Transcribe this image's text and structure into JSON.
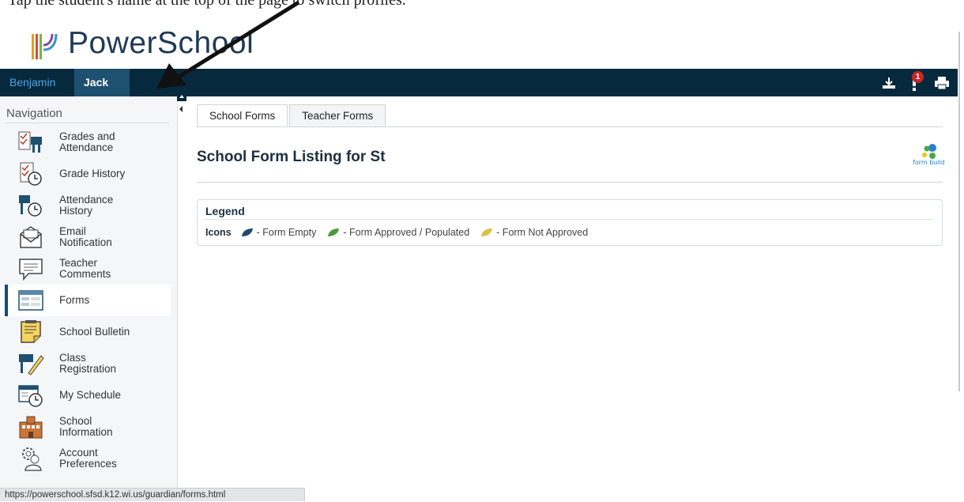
{
  "caption": "Tap the student's name at the top of the page to switch profiles.",
  "brand": {
    "name": "PowerSchool"
  },
  "students": [
    {
      "name": "Benjamin",
      "active": false
    },
    {
      "name": "Jack",
      "active": true
    }
  ],
  "header_icons": {
    "download": "download-icon",
    "notifications": "bell-icon",
    "notifications_count": "1",
    "print": "printer-icon"
  },
  "sidebar": {
    "title": "Navigation",
    "items": [
      {
        "label": "Grades and Attendance",
        "icon": "grades-attendance-icon",
        "active": false
      },
      {
        "label": "Grade History",
        "icon": "grade-history-icon",
        "active": false
      },
      {
        "label": "Attendance History",
        "icon": "attendance-history-icon",
        "active": false
      },
      {
        "label": "Email Notification",
        "icon": "email-icon",
        "active": false
      },
      {
        "label": "Teacher Comments",
        "icon": "comments-icon",
        "active": false
      },
      {
        "label": "Forms",
        "icon": "forms-icon",
        "active": true
      },
      {
        "label": "School Bulletin",
        "icon": "bulletin-icon",
        "active": false
      },
      {
        "label": "Class Registration",
        "icon": "registration-icon",
        "active": false
      },
      {
        "label": "My Schedule",
        "icon": "schedule-icon",
        "active": false
      },
      {
        "label": "School Information",
        "icon": "school-icon",
        "active": false
      },
      {
        "label": "Account Preferences",
        "icon": "account-icon",
        "active": false
      }
    ]
  },
  "main": {
    "tabs": [
      {
        "label": "School Forms",
        "active": true
      },
      {
        "label": "Teacher Forms",
        "active": false
      }
    ],
    "title": "School Form Listing for St",
    "logo": "form builder",
    "legend": {
      "title": "Legend",
      "lead": "Icons",
      "items": [
        {
          "label": "- Form Empty",
          "color": "#1f4a6b"
        },
        {
          "label": "- Form Approved / Populated",
          "color": "#4a9a3a"
        },
        {
          "label": "- Form Not Approved",
          "color": "#d8c24a"
        }
      ]
    }
  },
  "status_url": "https://powerschool.sfsd.k12.wi.us/guardian/forms.html",
  "colors": {
    "topbar": "#07293e",
    "accent": "#0e4e7a",
    "active_tab_bg": "#1e5070",
    "student_link": "#4ba6e6"
  }
}
